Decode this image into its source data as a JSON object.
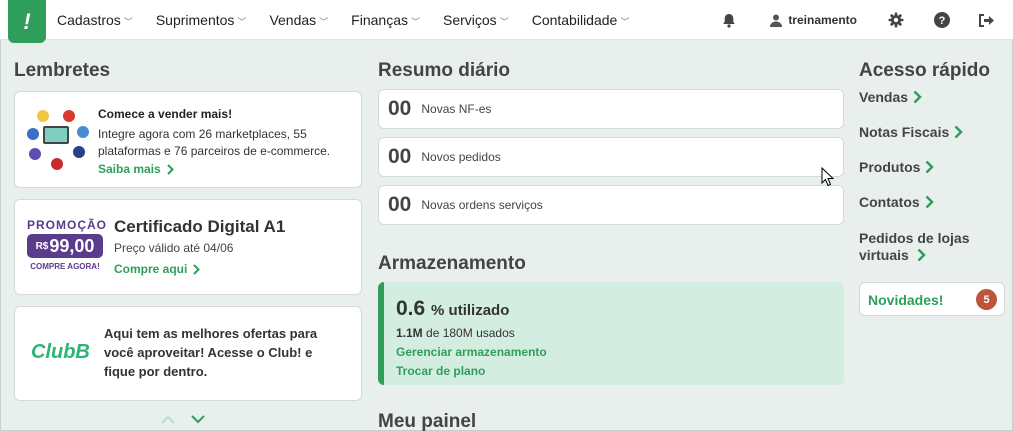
{
  "nav": {
    "logo": "!",
    "items": [
      {
        "label": "Cadastros"
      },
      {
        "label": "Suprimentos"
      },
      {
        "label": "Vendas"
      },
      {
        "label": "Finanças"
      },
      {
        "label": "Serviços"
      },
      {
        "label": "Contabilidade"
      }
    ],
    "user": "treinamento"
  },
  "lembretes": {
    "title": "Lembretes",
    "card1": {
      "title": "Comece a vender mais!",
      "desc": "Integre agora com 26 marketplaces, 55 plataformas e 76 parceiros de e-commerce.",
      "link": "Saiba mais"
    },
    "card2": {
      "promo_word": "PROMOÇÃO",
      "promo_currency": "R$",
      "promo_value": "99,00",
      "promo_cta": "COMPRE AGORA!",
      "title": "Certificado Digital A1",
      "desc": "Preço válido até 04/06",
      "link": "Compre aqui"
    },
    "card3": {
      "logo_text": "ClubB",
      "desc": "Aqui tem as melhores ofertas para você aproveitar! Acesse o Club! e fique por dentro."
    }
  },
  "resumo": {
    "title": "Resumo diário",
    "items": [
      {
        "value": "00",
        "label": "Novas NF-es"
      },
      {
        "value": "00",
        "label": "Novos pedidos"
      },
      {
        "value": "00",
        "label": "Novas ordens serviços"
      }
    ]
  },
  "armazenamento": {
    "title": "Armazenamento",
    "percent": "0.6",
    "percent_suffix": "% utilizado",
    "used_value": "1.1M",
    "used_rest": "de 180M usados",
    "link_manage": "Gerenciar armazenamento",
    "link_plan": "Trocar de plano"
  },
  "meu_painel": {
    "title": "Meu painel"
  },
  "acesso": {
    "title": "Acesso rápido",
    "items": [
      {
        "label": "Vendas"
      },
      {
        "label": "Notas Fiscais"
      },
      {
        "label": "Produtos"
      },
      {
        "label": "Contatos"
      }
    ],
    "multi_line": "Pedidos de lojas virtuais",
    "novidades": "Novidades!",
    "novidades_count": "5"
  },
  "colors": {
    "brand_green": "#2f9e5b",
    "promo_purple": "#5b3b8c",
    "badge_red": "#c0533c",
    "storage_bg": "#d3eee1"
  },
  "icons": [
    "bell-icon",
    "user-icon",
    "gear-icon",
    "help-icon",
    "logout-icon",
    "chevron-right-icon",
    "chevron-up-icon",
    "chevron-down-icon"
  ]
}
